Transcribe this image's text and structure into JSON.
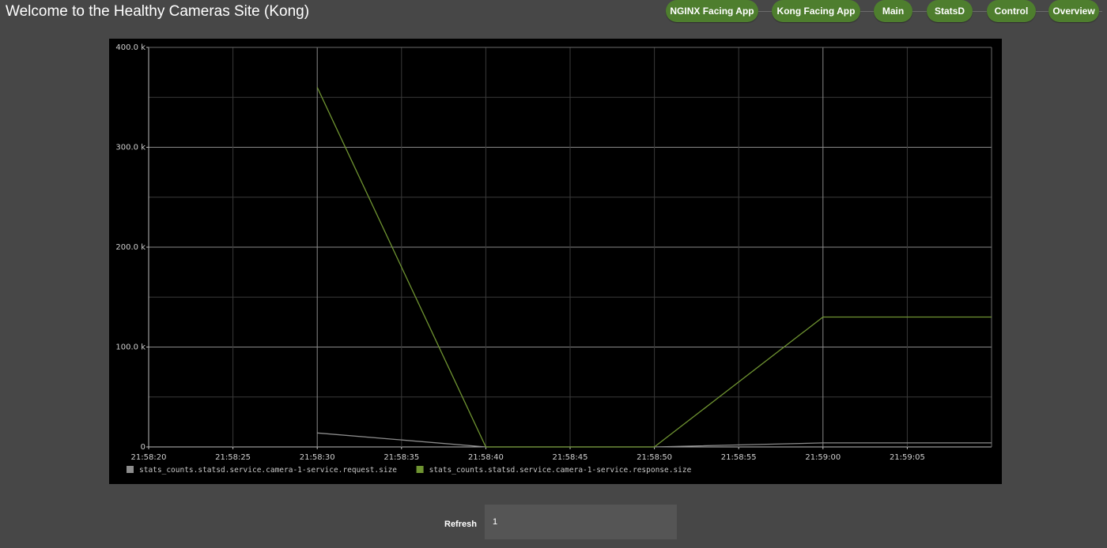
{
  "header": {
    "title": "Welcome to the Healthy Cameras Site (Kong)",
    "nav": [
      {
        "label": "NGINX Facing App"
      },
      {
        "label": "Kong Facing App"
      },
      {
        "label": "Main"
      },
      {
        "label": "StatsD"
      },
      {
        "label": "Control"
      },
      {
        "label": "Overview"
      }
    ]
  },
  "chart_data": {
    "type": "line",
    "x": [
      "21:58:30",
      "21:58:40",
      "21:58:50",
      "21:59:00",
      "21:59:10"
    ],
    "x_ticks": [
      "21:58:20",
      "21:58:25",
      "21:58:30",
      "21:58:35",
      "21:58:40",
      "21:58:45",
      "21:58:50",
      "21:58:55",
      "21:59:00",
      "21:59:05"
    ],
    "y_ticks": [
      "0",
      "100.0 k",
      "200.0 k",
      "300.0 k",
      "400.0 k"
    ],
    "ylim": [
      0,
      400000
    ],
    "grid": true,
    "legend_position": "bottom-left",
    "background": "#000000",
    "series": [
      {
        "name": "stats_counts.statsd.service.camera-1-service.request.size",
        "color": "#8c8c8c",
        "values": [
          14000,
          0,
          0,
          4000,
          4000
        ]
      },
      {
        "name": "stats_counts.statsd.service.camera-1-service.response.size",
        "color": "#6f9431",
        "values": [
          360000,
          0,
          0,
          130000,
          130000
        ]
      }
    ]
  },
  "refresh": {
    "label": "Refresh",
    "value": "1"
  }
}
